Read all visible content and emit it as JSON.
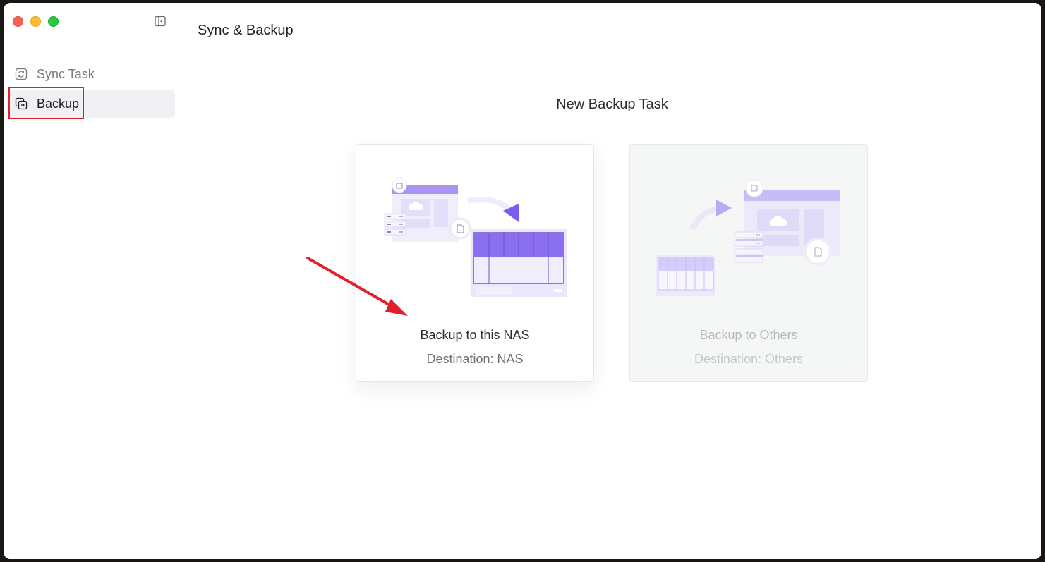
{
  "window": {
    "controls": [
      "close",
      "minimize",
      "maximize"
    ]
  },
  "sidebar": {
    "items": [
      {
        "label": "Sync Task",
        "icon": "sync-icon",
        "active": false
      },
      {
        "label": "Backup",
        "icon": "backup-icon",
        "active": true
      }
    ]
  },
  "header": {
    "title": "Sync & Backup"
  },
  "main": {
    "section_title": "New Backup Task",
    "cards": [
      {
        "title": "Backup to this NAS",
        "subtitle": "Destination: NAS",
        "enabled": true
      },
      {
        "title": "Backup to Others",
        "subtitle": "Destination: Others",
        "enabled": false
      }
    ]
  },
  "colors": {
    "accent": "#8a70f0",
    "annotation": "#e0202a"
  }
}
